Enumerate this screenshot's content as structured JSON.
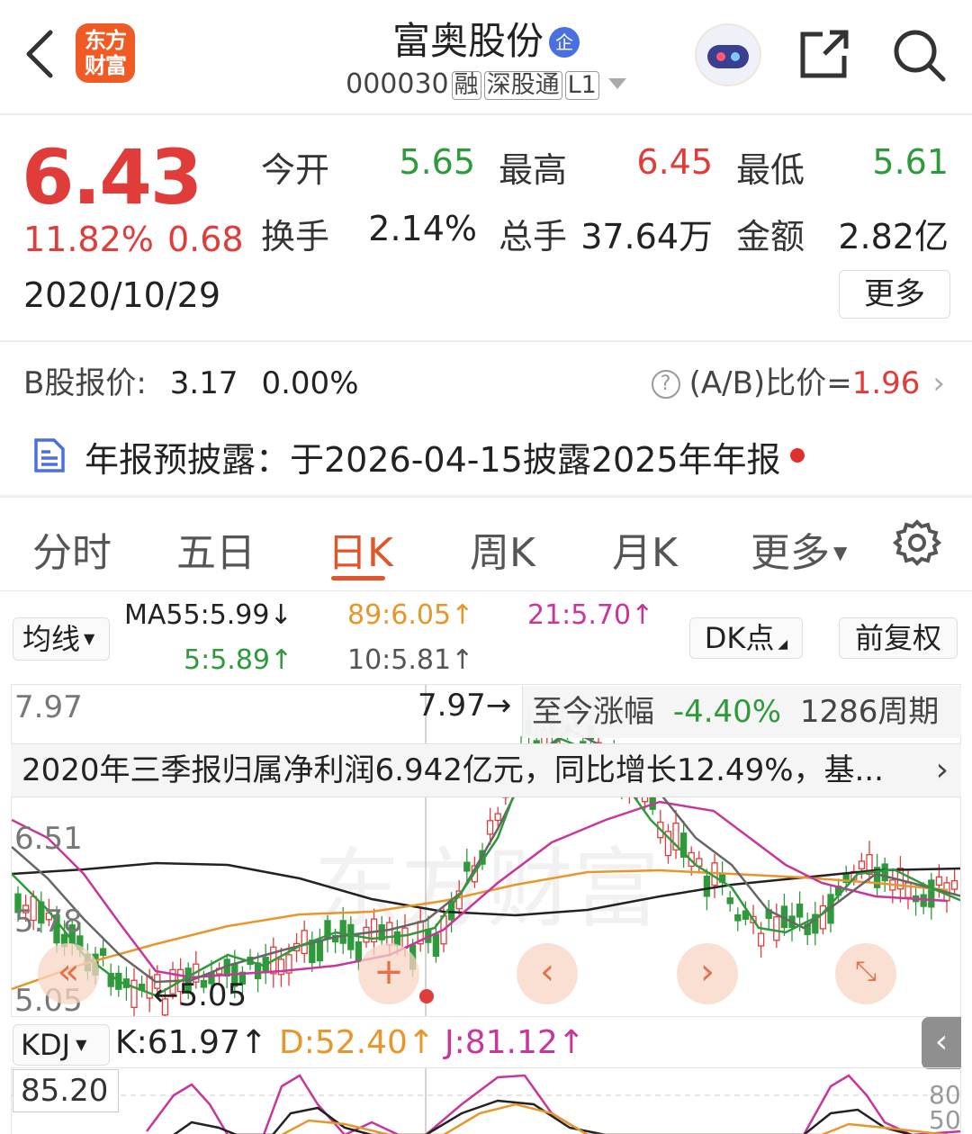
{
  "header": {
    "stock_name": "富奥股份",
    "badge": "企",
    "code": "000030",
    "tags": [
      "融",
      "深股通",
      "L1"
    ],
    "logo_line1": "东方",
    "logo_line2": "财富"
  },
  "quote": {
    "price": "6.43",
    "change_pct": "11.82%",
    "change": "0.68",
    "date": "2020/10/29",
    "open_label": "今开",
    "open": "5.65",
    "high_label": "最高",
    "high": "6.45",
    "low_label": "最低",
    "low": "5.61",
    "turnover_label": "换手",
    "turnover": "2.14%",
    "volume_label": "总手",
    "volume": "37.64万",
    "amount_label": "金额",
    "amount": "2.82亿",
    "more": "更多"
  },
  "b_share": {
    "label": "B股报价:",
    "price": "3.17",
    "pct": "0.00%",
    "ratio_label": "(A/B)比价=",
    "ratio": "1.96"
  },
  "notice": {
    "text": "年报预披露：于2026-04-15披露2025年年报"
  },
  "tabs": [
    "分时",
    "五日",
    "日K",
    "周K",
    "月K",
    "更多"
  ],
  "ma": {
    "selector": "均线",
    "ma55": "MA55:5.99↓",
    "ma89": "89:6.05↑",
    "ma21": "21:5.70↑",
    "ma5": "5:5.89↑",
    "ma10": "10:5.81↑",
    "dk": "DK点",
    "adjust": "前复权"
  },
  "chart": {
    "y_high": "7.97",
    "y_mid1": "6.51",
    "y_mid2": "5.78",
    "y_low": "5.05",
    "high_marker": "7.97→",
    "low_marker": "←5.05",
    "since_label": "至今涨幅",
    "since_pct": "-4.40%",
    "since_period": "1286周期",
    "banner": "2020年三季报归属净利润6.942亿元，同比增长12.49%，基...",
    "watermark": "东方财富"
  },
  "chart_data": {
    "type": "candlestick",
    "y_ticks": [
      "7.97",
      "6.51",
      "5.78",
      "5.05"
    ],
    "annotations": [
      "7.97",
      "5.05"
    ]
  },
  "kdj": {
    "selector": "KDJ",
    "k": "K:61.97↑",
    "d": "D:52.40↑",
    "j": "J:81.12↑",
    "max": "85.20",
    "tick80": "80",
    "tick50": "50"
  },
  "colors": {
    "up": "#e03c3a",
    "down": "#2e9a3c",
    "accent": "#e0552a"
  }
}
